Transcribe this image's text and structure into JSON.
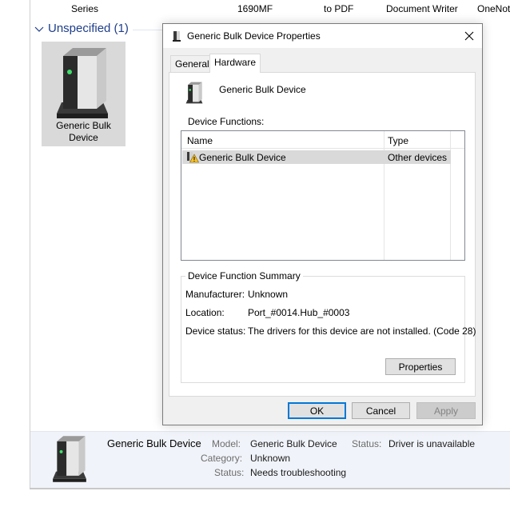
{
  "top_strip": {
    "col1": "Series",
    "col2": "1690MF",
    "col3": "to PDF",
    "col4": "Document Writer",
    "col5": "OneNot"
  },
  "group": {
    "title": "Unspecified (1)",
    "icon": "chevron-down-icon"
  },
  "device_tile": {
    "label_line1": "Generic Bulk",
    "label_line2": "Device",
    "icon": "generic-device-icon"
  },
  "details_pane": {
    "name": "Generic Bulk Device",
    "model_label": "Model:",
    "model_value": "Generic Bulk Device",
    "status_label": "Status:",
    "status_value": "Driver is unavailable",
    "category_label": "Category:",
    "category_value": "Unknown",
    "status2_label": "Status:",
    "status2_value": "Needs troubleshooting"
  },
  "dialog": {
    "title": "Generic Bulk Device Properties",
    "title_icon": "device-properties-icon",
    "close_icon": "close-icon",
    "tabs": [
      {
        "label": "General",
        "active": false
      },
      {
        "label": "Hardware",
        "active": true
      }
    ],
    "device_name": "Generic Bulk Device",
    "device_functions_label": "Device Functions:",
    "columns": {
      "name": "Name",
      "type": "Type"
    },
    "functions": [
      {
        "name": "Generic Bulk Device",
        "type": "Other devices",
        "icon": "warning-device-icon",
        "selected": true
      }
    ],
    "summary": {
      "title": "Device Function Summary",
      "manufacturer_label": "Manufacturer:",
      "manufacturer_value": "Unknown",
      "location_label": "Location:",
      "location_value": "Port_#0014.Hub_#0003",
      "status_label": "Device status:",
      "status_value": "The drivers for this device are not installed. (Code 28)"
    },
    "buttons": {
      "properties": "Properties",
      "ok": "OK",
      "cancel": "Cancel",
      "apply": "Apply"
    }
  },
  "colors": {
    "accent": "#0078d7",
    "group_title": "#1e3e8a",
    "selection": "#d9d9d9",
    "details_bg": "#f0f3f9"
  }
}
